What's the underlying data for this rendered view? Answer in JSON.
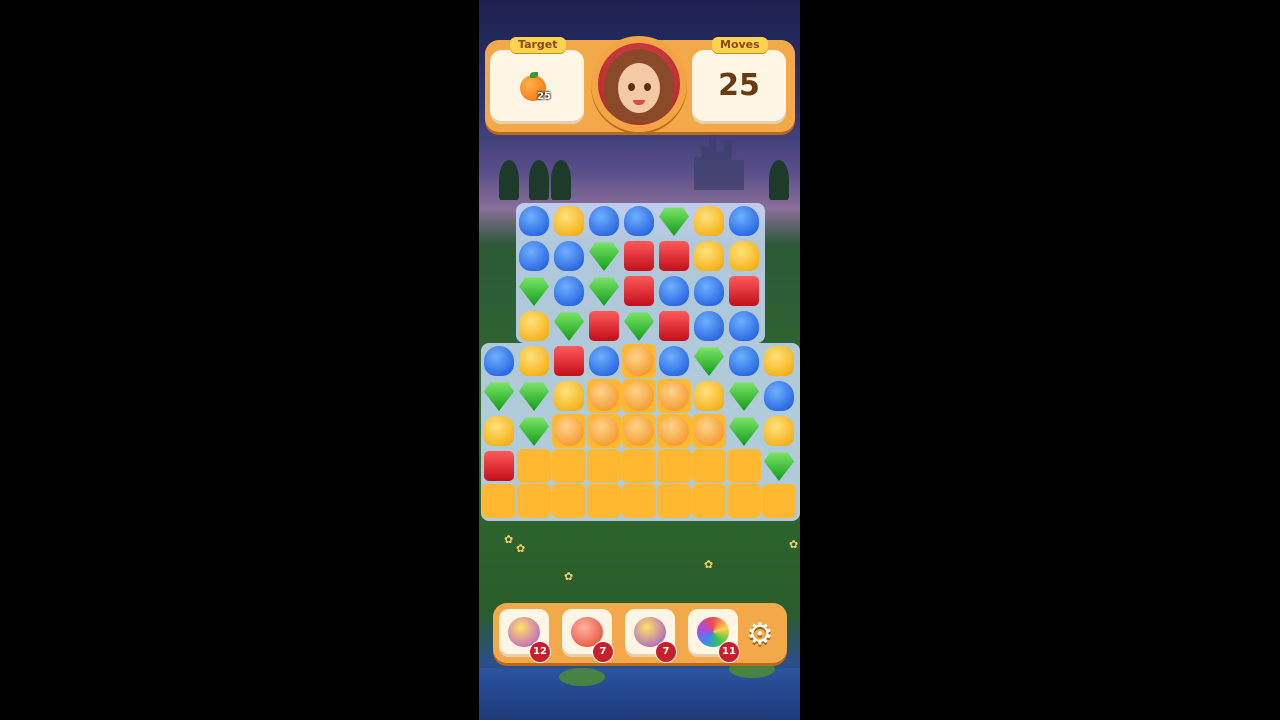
{
  "hud": {
    "target_label": "Target",
    "moves_label": "Moves",
    "moves_value": "25",
    "target_item": "orange-icon",
    "target_count": "25"
  },
  "colors": {
    "blue": "#1552d8",
    "yellow": "#f2a400",
    "green": "#129a1a",
    "red": "#c20e1a",
    "orange": "#f18a12",
    "jelly": "#ffb830"
  },
  "board": {
    "rows": [
      [
        "",
        "blue",
        "yellow",
        "blue",
        "blue",
        "green",
        "yellow",
        "blue",
        ""
      ],
      [
        "",
        "blue",
        "blue",
        "green",
        "red",
        "red",
        "yellow",
        "yellow",
        ""
      ],
      [
        "",
        "green",
        "blue",
        "green",
        "red",
        "blue",
        "blue",
        "red",
        ""
      ],
      [
        "",
        "yellow",
        "green",
        "red",
        "green",
        "red",
        "blue",
        "blue",
        ""
      ],
      [
        "blue",
        "yellow",
        "red",
        "blue",
        "orange",
        "blue",
        "green",
        "blue",
        "yellow"
      ],
      [
        "green",
        "green",
        "yellow",
        "orange",
        "orange",
        "orange",
        "yellow",
        "green",
        "blue"
      ],
      [
        "yellow",
        "green",
        "orange",
        "orange",
        "orange",
        "orange",
        "orange",
        "green",
        "yellow"
      ],
      [
        "red",
        "",
        "",
        "",
        "",
        "",
        "",
        "",
        "green"
      ],
      [
        "",
        "",
        "",
        "",
        "",
        "",
        "",
        "",
        ""
      ]
    ],
    "jelly": [
      [
        0,
        0,
        0,
        0,
        0,
        0,
        0,
        0,
        0
      ],
      [
        0,
        0,
        0,
        0,
        0,
        0,
        0,
        0,
        0
      ],
      [
        0,
        0,
        0,
        0,
        0,
        0,
        0,
        0,
        0
      ],
      [
        0,
        0,
        0,
        0,
        0,
        0,
        0,
        0,
        0
      ],
      [
        0,
        0,
        0,
        0,
        1,
        0,
        0,
        0,
        0
      ],
      [
        0,
        0,
        0,
        1,
        1,
        1,
        0,
        0,
        0
      ],
      [
        0,
        0,
        1,
        1,
        1,
        1,
        1,
        0,
        0
      ],
      [
        0,
        1,
        1,
        1,
        1,
        1,
        1,
        1,
        0
      ],
      [
        1,
        1,
        1,
        1,
        1,
        1,
        1,
        1,
        1
      ]
    ]
  },
  "boosters": [
    {
      "icon": "magic-wand-icon",
      "count": "12"
    },
    {
      "icon": "skull-bomb-icon",
      "count": "7"
    },
    {
      "icon": "cross-blast-icon",
      "count": "7"
    },
    {
      "icon": "rainbow-ball-icon",
      "count": "11"
    }
  ],
  "settings_icon": "gear-icon"
}
